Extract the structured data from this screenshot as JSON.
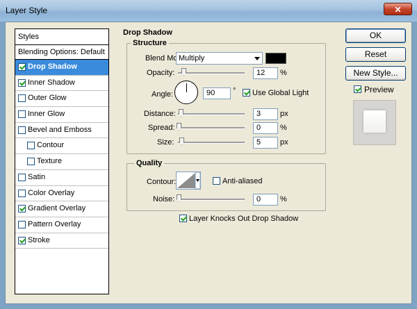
{
  "window": {
    "title": "Layer Style",
    "close_glyph": "✕"
  },
  "styles_panel": {
    "header": "Styles",
    "blending_options": "Blending Options: Default",
    "items": [
      {
        "label": "Drop Shadow",
        "checked": true,
        "selected": true,
        "indent": false
      },
      {
        "label": "Inner Shadow",
        "checked": true,
        "selected": false,
        "indent": false
      },
      {
        "label": "Outer Glow",
        "checked": false,
        "selected": false,
        "indent": false
      },
      {
        "label": "Inner Glow",
        "checked": false,
        "selected": false,
        "indent": false
      },
      {
        "label": "Bevel and Emboss",
        "checked": false,
        "selected": false,
        "indent": false
      },
      {
        "label": "Contour",
        "checked": false,
        "selected": false,
        "indent": true
      },
      {
        "label": "Texture",
        "checked": false,
        "selected": false,
        "indent": true
      },
      {
        "label": "Satin",
        "checked": false,
        "selected": false,
        "indent": false
      },
      {
        "label": "Color Overlay",
        "checked": false,
        "selected": false,
        "indent": false
      },
      {
        "label": "Gradient Overlay",
        "checked": true,
        "selected": false,
        "indent": false
      },
      {
        "label": "Pattern Overlay",
        "checked": false,
        "selected": false,
        "indent": false
      },
      {
        "label": "Stroke",
        "checked": true,
        "selected": false,
        "indent": false
      }
    ]
  },
  "drop_shadow": {
    "section_title": "Drop Shadow",
    "structure": {
      "title": "Structure",
      "blend_mode_label": "Blend Mode:",
      "blend_mode_value": "Multiply",
      "shadow_color": "#000000",
      "opacity_label": "Opacity:",
      "opacity_value": "12",
      "opacity_unit": "%",
      "angle_label": "Angle:",
      "angle_value": "90",
      "angle_unit": "°",
      "use_global_light_label": "Use Global Light",
      "use_global_light_checked": true,
      "distance_label": "Distance:",
      "distance_value": "3",
      "distance_unit": "px",
      "spread_label": "Spread:",
      "spread_value": "0",
      "spread_unit": "%",
      "size_label": "Size:",
      "size_value": "5",
      "size_unit": "px"
    },
    "quality": {
      "title": "Quality",
      "contour_label": "Contour:",
      "anti_aliased_label": "Anti-aliased",
      "anti_aliased_checked": false,
      "noise_label": "Noise:",
      "noise_value": "0",
      "noise_unit": "%"
    },
    "knockout_label": "Layer Knocks Out Drop Shadow",
    "knockout_checked": true
  },
  "buttons": {
    "ok": "OK",
    "reset": "Reset",
    "new_style": "New Style...",
    "preview_label": "Preview",
    "preview_checked": true
  }
}
